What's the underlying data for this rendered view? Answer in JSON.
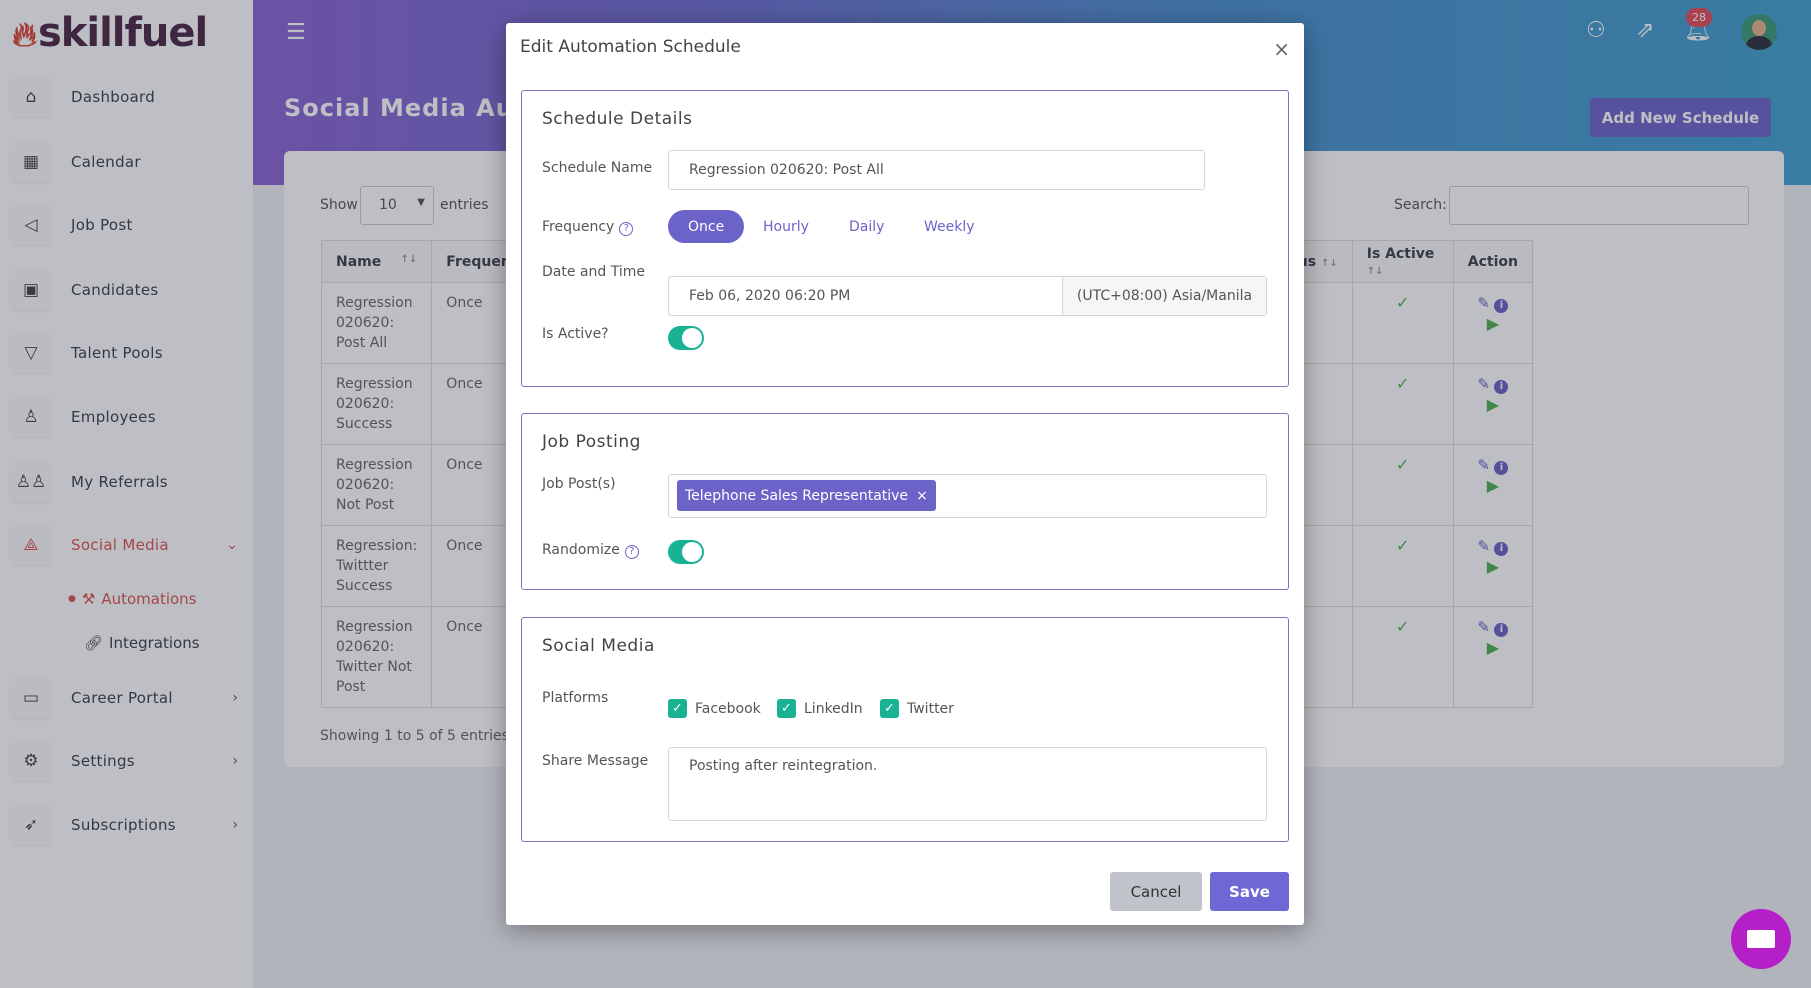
{
  "brand": {
    "name": "skillfuel"
  },
  "sidebar": {
    "items": [
      {
        "label": "Dashboard",
        "icon": "home-icon"
      },
      {
        "label": "Calendar",
        "icon": "calendar-icon"
      },
      {
        "label": "Job Post",
        "icon": "megaphone-icon"
      },
      {
        "label": "Candidates",
        "icon": "candidates-icon"
      },
      {
        "label": "Talent Pools",
        "icon": "filter-icon"
      },
      {
        "label": "Employees",
        "icon": "user-icon"
      },
      {
        "label": "My Referrals",
        "icon": "users-icon"
      },
      {
        "label": "Social Media",
        "icon": "share-icon",
        "active": true
      },
      {
        "label": "Career Portal",
        "icon": "monitor-icon"
      },
      {
        "label": "Settings",
        "icon": "gear-icon"
      },
      {
        "label": "Subscriptions",
        "icon": "rocket-icon"
      }
    ],
    "subitems": [
      {
        "label": "Automations",
        "active": true
      },
      {
        "label": "Integrations"
      }
    ]
  },
  "header": {
    "title": "Social Media Automations",
    "add_button": "Add New Schedule",
    "notification_count": "28"
  },
  "table": {
    "show_label": "Show",
    "page_size": "10",
    "entries_label": "entries",
    "search_label": "Search:",
    "columns": [
      "Name",
      "Frequency",
      "tus",
      "Is Active",
      "Action"
    ],
    "rows": [
      {
        "name": "Regression 020620: Post All",
        "frequency": "Once"
      },
      {
        "name": "Regression 020620: Success",
        "frequency": "Once"
      },
      {
        "name": "Regression 020620: Not Post",
        "frequency": "Once"
      },
      {
        "name": "Regression: Twittter Success",
        "frequency": "Once"
      },
      {
        "name": "Regression 020620: Twitter Not Post",
        "frequency": "Once"
      }
    ],
    "footer": "Showing 1 to 5 of 5 entries"
  },
  "modal": {
    "title": "Edit Automation Schedule",
    "close": "×",
    "schedule_details": {
      "title": "Schedule Details",
      "name_label": "Schedule Name",
      "name_value": "Regression 020620: Post All",
      "frequency_label": "Frequency",
      "frequency_options": [
        "Once",
        "Hourly",
        "Daily",
        "Weekly"
      ],
      "frequency_selected": "Once",
      "datetime_label": "Date and Time",
      "datetime_value": "Feb 06, 2020 06:20 PM",
      "timezone": "(UTC+08:00) Asia/Manila",
      "active_label": "Is Active?",
      "active": true
    },
    "job_posting": {
      "title": "Job Posting",
      "jobs_label": "Job Post(s)",
      "jobs": [
        "Telephone Sales Representative"
      ],
      "randomize_label": "Randomize",
      "randomize": true
    },
    "social_media": {
      "title": "Social Media",
      "platforms_label": "Platforms",
      "platforms": [
        {
          "label": "Facebook",
          "checked": true
        },
        {
          "label": "LinkedIn",
          "checked": true
        },
        {
          "label": "Twitter",
          "checked": true
        }
      ],
      "message_label": "Share Message",
      "message_value": "Posting after reintegration."
    },
    "cancel": "Cancel",
    "save": "Save"
  },
  "colors": {
    "accent": "#6c63c9",
    "active_nav": "#d9534f",
    "toggle": "#19b394",
    "chat": "#b41fc7"
  }
}
